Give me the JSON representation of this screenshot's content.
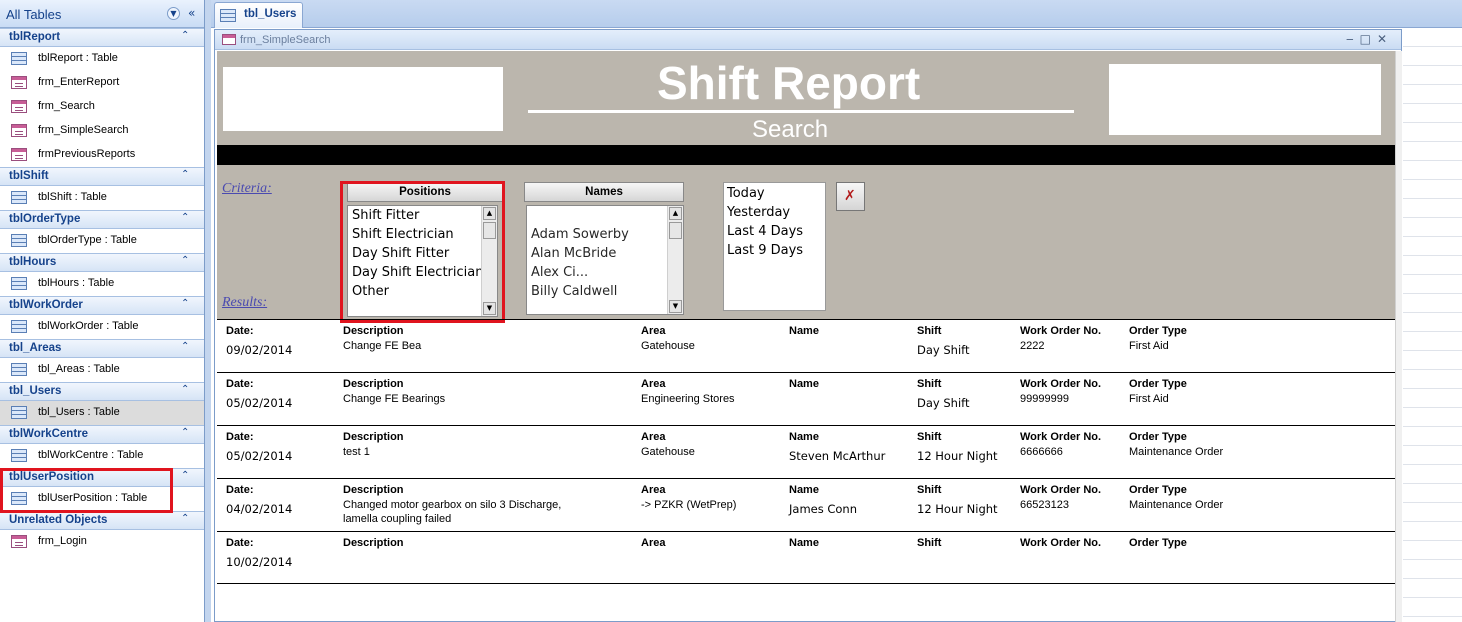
{
  "nav": {
    "title": "All Tables",
    "groups": [
      {
        "label": "tblReport",
        "items": [
          {
            "label": "tblReport : Table",
            "type": "table"
          },
          {
            "label": "frm_EnterReport",
            "type": "form"
          },
          {
            "label": "frm_Search",
            "type": "form"
          },
          {
            "label": "frm_SimpleSearch",
            "type": "form"
          },
          {
            "label": "frmPreviousReports",
            "type": "form"
          }
        ]
      },
      {
        "label": "tblShift",
        "items": [
          {
            "label": "tblShift : Table",
            "type": "table"
          }
        ]
      },
      {
        "label": "tblOrderType",
        "items": [
          {
            "label": "tblOrderType : Table",
            "type": "table"
          }
        ]
      },
      {
        "label": "tblHours",
        "items": [
          {
            "label": "tblHours : Table",
            "type": "table"
          }
        ]
      },
      {
        "label": "tblWorkOrder",
        "items": [
          {
            "label": "tblWorkOrder : Table",
            "type": "table"
          }
        ]
      },
      {
        "label": "tbl_Areas",
        "items": [
          {
            "label": "tbl_Areas : Table",
            "type": "table"
          }
        ]
      },
      {
        "label": "tbl_Users",
        "items": [
          {
            "label": "tbl_Users : Table",
            "type": "table",
            "selected": true
          }
        ]
      },
      {
        "label": "tblWorkCentre",
        "items": [
          {
            "label": "tblWorkCentre : Table",
            "type": "table"
          }
        ]
      },
      {
        "label": "tblUserPosition",
        "items": [
          {
            "label": "tblUserPosition : Table",
            "type": "table"
          }
        ]
      },
      {
        "label": "Unrelated Objects",
        "items": [
          {
            "label": "frm_Login",
            "type": "form"
          }
        ]
      }
    ]
  },
  "doc_tab": {
    "label": "tbl_Users"
  },
  "form": {
    "window_title": "frm_SimpleSearch",
    "header_title": "Shift Report",
    "header_subtitle": "Search",
    "criteria_label": "Criteria:",
    "results_label": "Results:",
    "positions": {
      "header": "Positions",
      "items": [
        "Shift Fitter",
        "Shift Electrician",
        "Day Shift Fitter",
        "Day Shift Electrician",
        "Other"
      ]
    },
    "names": {
      "header": "Names",
      "items": [
        "Adam Sowerby",
        "Alan McBride",
        "Alex Ci...",
        "Billy Caldwell"
      ]
    },
    "date_options": [
      "Today",
      "Yesterday",
      "Last 4 Days",
      "Last 9 Days"
    ],
    "result_headers": {
      "date": "Date:",
      "description": "Description",
      "area": "Area",
      "name": "Name",
      "shift": "Shift",
      "work_order": "Work Order No.",
      "order_type": "Order Type"
    },
    "results": [
      {
        "date": "09/02/2014",
        "description": "Change FE Bea",
        "area": "Gatehouse",
        "name": "",
        "shift": "Day Shift",
        "work_order": "2222",
        "order_type": "First Aid"
      },
      {
        "date": "05/02/2014",
        "description": "Change FE Bearings",
        "area": "Engineering Stores",
        "name": "",
        "shift": "Day Shift",
        "work_order": "99999999",
        "order_type": "First Aid"
      },
      {
        "date": "05/02/2014",
        "description": "test 1",
        "area": "Gatehouse",
        "name": "Steven McArthur",
        "shift": "12 Hour Night",
        "work_order": "6666666",
        "order_type": "Maintenance Order"
      },
      {
        "date": "04/02/2014",
        "description": "Changed motor gearbox on silo 3 Discharge,",
        "description2": "lamella coupling failed",
        "area": "->      PZKR (WetPrep)",
        "name": "James Conn",
        "shift": "12 Hour Night",
        "work_order": "66523123",
        "order_type": "Maintenance Order"
      },
      {
        "date": "10/02/2014",
        "description": "",
        "area": "",
        "name": "",
        "shift": "",
        "work_order": "",
        "order_type": ""
      }
    ]
  },
  "colors": {
    "highlight": "#e0141e",
    "form_bg": "#bbb6ad",
    "nav_text": "#15428b"
  }
}
